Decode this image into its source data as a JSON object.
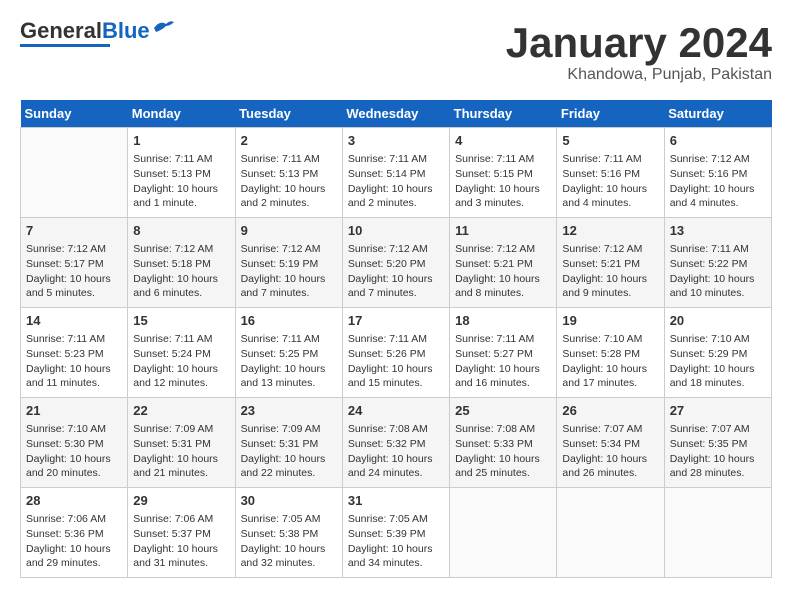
{
  "logo": {
    "general": "General",
    "blue": "Blue"
  },
  "header": {
    "month": "January 2024",
    "location": "Khandowa, Punjab, Pakistan"
  },
  "weekdays": [
    "Sunday",
    "Monday",
    "Tuesday",
    "Wednesday",
    "Thursday",
    "Friday",
    "Saturday"
  ],
  "weeks": [
    [
      {
        "day": "",
        "info": ""
      },
      {
        "day": "1",
        "info": "Sunrise: 7:11 AM\nSunset: 5:13 PM\nDaylight: 10 hours\nand 1 minute."
      },
      {
        "day": "2",
        "info": "Sunrise: 7:11 AM\nSunset: 5:13 PM\nDaylight: 10 hours\nand 2 minutes."
      },
      {
        "day": "3",
        "info": "Sunrise: 7:11 AM\nSunset: 5:14 PM\nDaylight: 10 hours\nand 2 minutes."
      },
      {
        "day": "4",
        "info": "Sunrise: 7:11 AM\nSunset: 5:15 PM\nDaylight: 10 hours\nand 3 minutes."
      },
      {
        "day": "5",
        "info": "Sunrise: 7:11 AM\nSunset: 5:16 PM\nDaylight: 10 hours\nand 4 minutes."
      },
      {
        "day": "6",
        "info": "Sunrise: 7:12 AM\nSunset: 5:16 PM\nDaylight: 10 hours\nand 4 minutes."
      }
    ],
    [
      {
        "day": "7",
        "info": "Sunrise: 7:12 AM\nSunset: 5:17 PM\nDaylight: 10 hours\nand 5 minutes."
      },
      {
        "day": "8",
        "info": "Sunrise: 7:12 AM\nSunset: 5:18 PM\nDaylight: 10 hours\nand 6 minutes."
      },
      {
        "day": "9",
        "info": "Sunrise: 7:12 AM\nSunset: 5:19 PM\nDaylight: 10 hours\nand 7 minutes."
      },
      {
        "day": "10",
        "info": "Sunrise: 7:12 AM\nSunset: 5:20 PM\nDaylight: 10 hours\nand 7 minutes."
      },
      {
        "day": "11",
        "info": "Sunrise: 7:12 AM\nSunset: 5:21 PM\nDaylight: 10 hours\nand 8 minutes."
      },
      {
        "day": "12",
        "info": "Sunrise: 7:12 AM\nSunset: 5:21 PM\nDaylight: 10 hours\nand 9 minutes."
      },
      {
        "day": "13",
        "info": "Sunrise: 7:11 AM\nSunset: 5:22 PM\nDaylight: 10 hours\nand 10 minutes."
      }
    ],
    [
      {
        "day": "14",
        "info": "Sunrise: 7:11 AM\nSunset: 5:23 PM\nDaylight: 10 hours\nand 11 minutes."
      },
      {
        "day": "15",
        "info": "Sunrise: 7:11 AM\nSunset: 5:24 PM\nDaylight: 10 hours\nand 12 minutes."
      },
      {
        "day": "16",
        "info": "Sunrise: 7:11 AM\nSunset: 5:25 PM\nDaylight: 10 hours\nand 13 minutes."
      },
      {
        "day": "17",
        "info": "Sunrise: 7:11 AM\nSunset: 5:26 PM\nDaylight: 10 hours\nand 15 minutes."
      },
      {
        "day": "18",
        "info": "Sunrise: 7:11 AM\nSunset: 5:27 PM\nDaylight: 10 hours\nand 16 minutes."
      },
      {
        "day": "19",
        "info": "Sunrise: 7:10 AM\nSunset: 5:28 PM\nDaylight: 10 hours\nand 17 minutes."
      },
      {
        "day": "20",
        "info": "Sunrise: 7:10 AM\nSunset: 5:29 PM\nDaylight: 10 hours\nand 18 minutes."
      }
    ],
    [
      {
        "day": "21",
        "info": "Sunrise: 7:10 AM\nSunset: 5:30 PM\nDaylight: 10 hours\nand 20 minutes."
      },
      {
        "day": "22",
        "info": "Sunrise: 7:09 AM\nSunset: 5:31 PM\nDaylight: 10 hours\nand 21 minutes."
      },
      {
        "day": "23",
        "info": "Sunrise: 7:09 AM\nSunset: 5:31 PM\nDaylight: 10 hours\nand 22 minutes."
      },
      {
        "day": "24",
        "info": "Sunrise: 7:08 AM\nSunset: 5:32 PM\nDaylight: 10 hours\nand 24 minutes."
      },
      {
        "day": "25",
        "info": "Sunrise: 7:08 AM\nSunset: 5:33 PM\nDaylight: 10 hours\nand 25 minutes."
      },
      {
        "day": "26",
        "info": "Sunrise: 7:07 AM\nSunset: 5:34 PM\nDaylight: 10 hours\nand 26 minutes."
      },
      {
        "day": "27",
        "info": "Sunrise: 7:07 AM\nSunset: 5:35 PM\nDaylight: 10 hours\nand 28 minutes."
      }
    ],
    [
      {
        "day": "28",
        "info": "Sunrise: 7:06 AM\nSunset: 5:36 PM\nDaylight: 10 hours\nand 29 minutes."
      },
      {
        "day": "29",
        "info": "Sunrise: 7:06 AM\nSunset: 5:37 PM\nDaylight: 10 hours\nand 31 minutes."
      },
      {
        "day": "30",
        "info": "Sunrise: 7:05 AM\nSunset: 5:38 PM\nDaylight: 10 hours\nand 32 minutes."
      },
      {
        "day": "31",
        "info": "Sunrise: 7:05 AM\nSunset: 5:39 PM\nDaylight: 10 hours\nand 34 minutes."
      },
      {
        "day": "",
        "info": ""
      },
      {
        "day": "",
        "info": ""
      },
      {
        "day": "",
        "info": ""
      }
    ]
  ]
}
